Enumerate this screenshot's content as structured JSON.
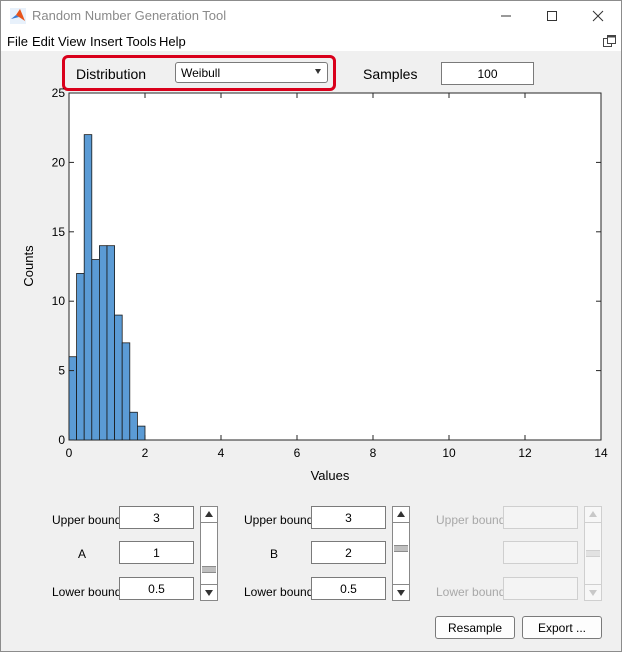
{
  "window": {
    "title": "Random Number Generation Tool"
  },
  "menu": [
    "File",
    "Edit",
    "View",
    "Insert",
    "Tools",
    "Help"
  ],
  "controls": {
    "distribution_label": "Distribution",
    "distribution_value": "Weibull",
    "samples_label": "Samples",
    "samples_value": "100"
  },
  "chart_data": {
    "type": "bar",
    "xlabel": "Values",
    "ylabel": "Counts",
    "xlim": [
      0,
      14
    ],
    "ylim": [
      0,
      25
    ],
    "xticks": [
      0,
      2,
      4,
      6,
      8,
      10,
      12,
      14
    ],
    "yticks": [
      0,
      5,
      10,
      15,
      20,
      25
    ],
    "bin_width": 0.2,
    "bins": [
      {
        "x0": 0.0,
        "x1": 0.2,
        "count": 6
      },
      {
        "x0": 0.2,
        "x1": 0.4,
        "count": 12
      },
      {
        "x0": 0.4,
        "x1": 0.6,
        "count": 22
      },
      {
        "x0": 0.6,
        "x1": 0.8,
        "count": 13
      },
      {
        "x0": 0.8,
        "x1": 1.0,
        "count": 14
      },
      {
        "x0": 1.0,
        "x1": 1.2,
        "count": 14
      },
      {
        "x0": 1.2,
        "x1": 1.4,
        "count": 9
      },
      {
        "x0": 1.4,
        "x1": 1.6,
        "count": 7
      },
      {
        "x0": 1.6,
        "x1": 1.8,
        "count": 2
      },
      {
        "x0": 1.8,
        "x1": 2.0,
        "count": 1
      }
    ],
    "grid": false,
    "bar_color": "#5b9bd5",
    "edge_color": "#1a1a1a"
  },
  "params": [
    {
      "upper_label": "Upper bound",
      "upper_value": "3",
      "name_label": "A",
      "value": "1",
      "lower_label": "Lower bound",
      "lower_value": "0.5",
      "slider_level": 0.2,
      "enabled": true
    },
    {
      "upper_label": "Upper bound",
      "upper_value": "3",
      "name_label": "B",
      "value": "2",
      "lower_label": "Lower bound",
      "lower_value": "0.5",
      "slider_level": 0.6,
      "enabled": true
    },
    {
      "upper_label": "Upper bound",
      "upper_value": "",
      "name_label": "",
      "value": "",
      "lower_label": "Lower bound",
      "lower_value": "",
      "slider_level": 0.5,
      "enabled": false
    }
  ],
  "buttons": {
    "resample": "Resample",
    "export": "Export ..."
  },
  "colors": {
    "highlight": "#d9001b",
    "bar": "#5b9bd5"
  },
  "icons": {
    "app": "matlab-logo-icon",
    "minimize": "minimize-icon",
    "maximize": "maximize-icon",
    "close": "close-icon",
    "undock": "undock-icon"
  }
}
